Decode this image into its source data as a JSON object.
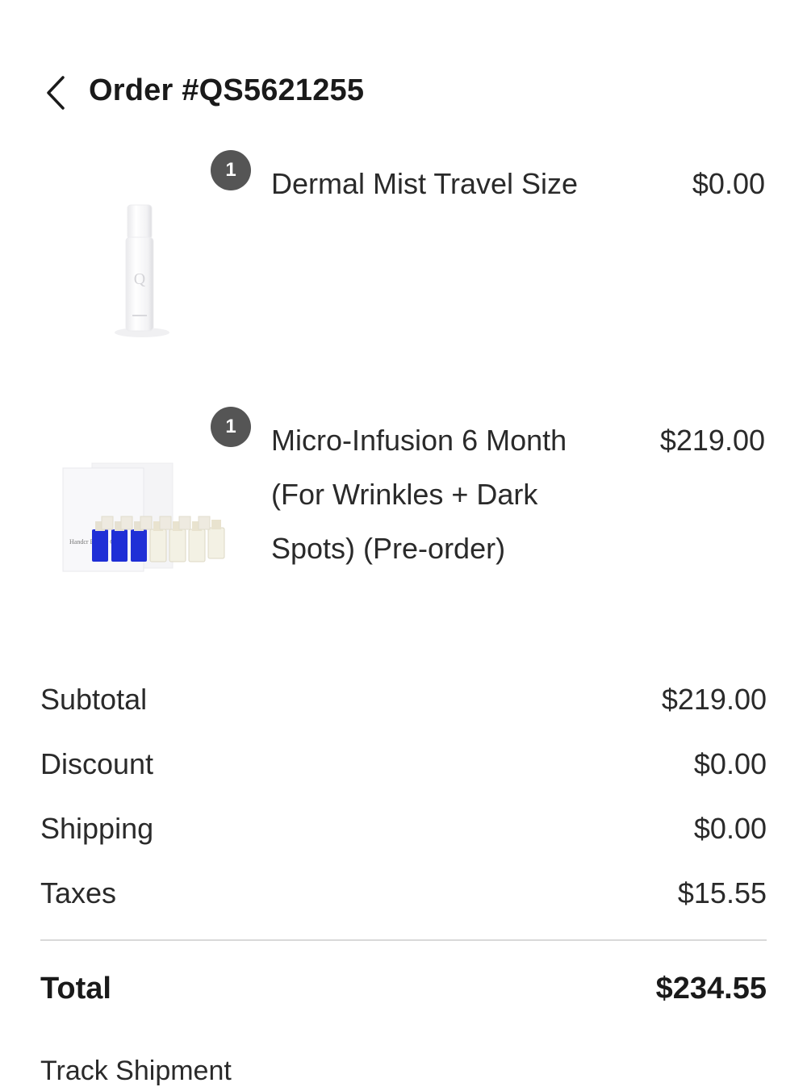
{
  "header": {
    "back_icon": "chevron-left-icon",
    "title": "Order #QS5621255"
  },
  "items": [
    {
      "quantity": "1",
      "name": "Dermal Mist Travel Size",
      "price": "$0.00",
      "image": "dermal-mist-bottle-image",
      "image_mark": "Q"
    },
    {
      "quantity": "1",
      "name": "Micro-Infusion 6 Month (For Wrinkles + Dark Spots) (Pre-order)",
      "price": "$219.00",
      "image": "micro-infusion-kit-image",
      "image_mark": "Handcr Beauty C"
    }
  ],
  "summary": {
    "subtotal_label": "Subtotal",
    "subtotal_value": "$219.00",
    "discount_label": "Discount",
    "discount_value": "$0.00",
    "shipping_label": "Shipping",
    "shipping_value": "$0.00",
    "taxes_label": "Taxes",
    "taxes_value": "$15.55",
    "total_label": "Total",
    "total_value": "$234.55"
  },
  "track_shipment": "Track Shipment",
  "colors": {
    "badge": "#555555",
    "text": "#2a2a2a",
    "divider": "#d9d9d9",
    "vial_blue": "#1f2fd6"
  }
}
